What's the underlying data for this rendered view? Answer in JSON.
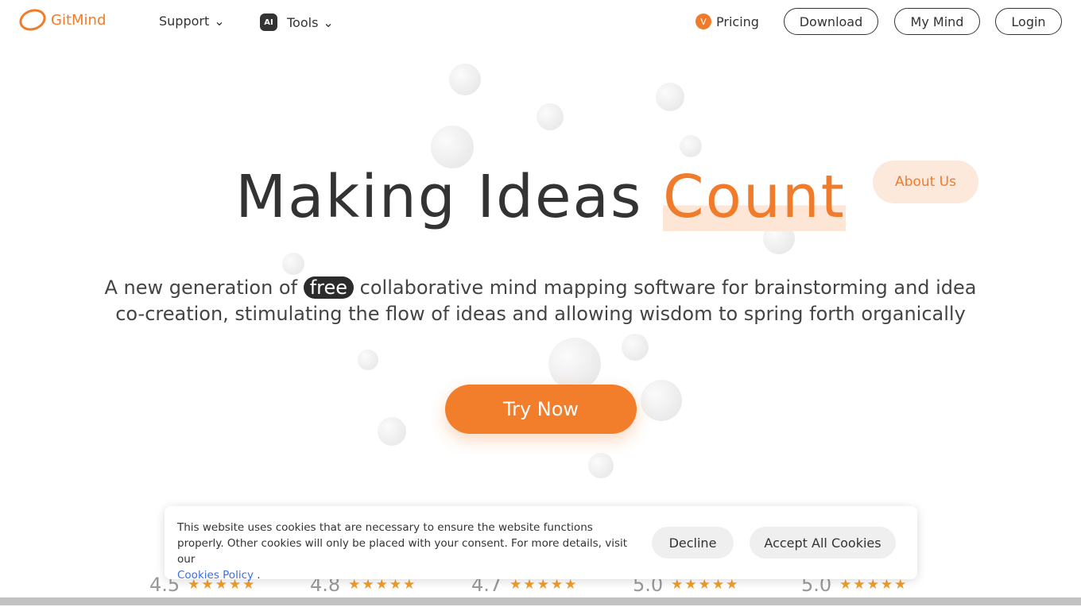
{
  "nav": {
    "logo": "GitMind",
    "support": "Support",
    "tools": "Tools",
    "ai_badge": "AI",
    "pricing": "Pricing",
    "download": "Download",
    "my_mind": "My Mind",
    "login": "Login"
  },
  "hero": {
    "title_a": "Making Ideas",
    "title_b": "Count",
    "about": "About Us",
    "sub_a": "A new generation of",
    "free": "free",
    "sub_b": "collaborative mind mapping software for brainstorming and idea co-creation, stimulating the flow of ideas and allowing wisdom to spring forth organically",
    "cta": "Try Now"
  },
  "ratings": [
    {
      "score": "4.5",
      "stars": 5
    },
    {
      "score": "4.8",
      "stars": 5
    },
    {
      "score": "4.7",
      "stars": 5
    },
    {
      "score": "5.0",
      "stars": 5
    },
    {
      "score": "5.0",
      "stars": 5
    }
  ],
  "cookie": {
    "text": "This website uses cookies that are necessary to ensure the website functions properly. Other cookies will only be placed with your consent. For more details, visit our",
    "link": "Cookies Policy",
    "period": ".",
    "decline": "Decline",
    "accept": "Accept All Cookies"
  },
  "colors": {
    "accent": "#f27d2a"
  }
}
